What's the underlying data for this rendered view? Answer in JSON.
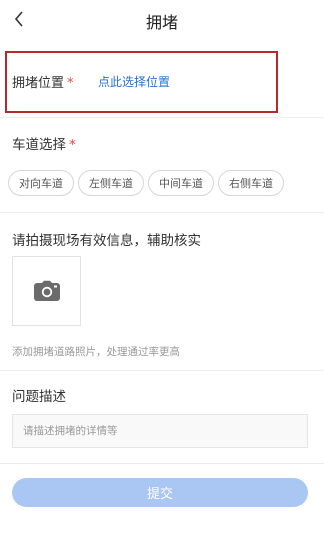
{
  "header": {
    "back_icon": "chevron-left-icon",
    "title": "拥堵"
  },
  "location": {
    "label": "拥堵位置",
    "required_mark": "*",
    "link_text": "点此选择位置"
  },
  "lanes": {
    "title": "车道选择",
    "required_mark": "*",
    "options": [
      "对向车道",
      "左侧车道",
      "中间车道",
      "右侧车道"
    ]
  },
  "photo": {
    "title": "请拍摄现场有效信息，辅助核实",
    "icon": "camera-icon",
    "hint": "添加拥堵道路照片，处理通过率更高"
  },
  "description": {
    "title": "问题描述",
    "placeholder": "请描述拥堵的详情等"
  },
  "submit": {
    "label": "提交"
  },
  "colors": {
    "highlight_border": "#b32a2a",
    "required": "#e34848",
    "link": "#2b6fd0",
    "submit_bg": "#aac6f3"
  }
}
